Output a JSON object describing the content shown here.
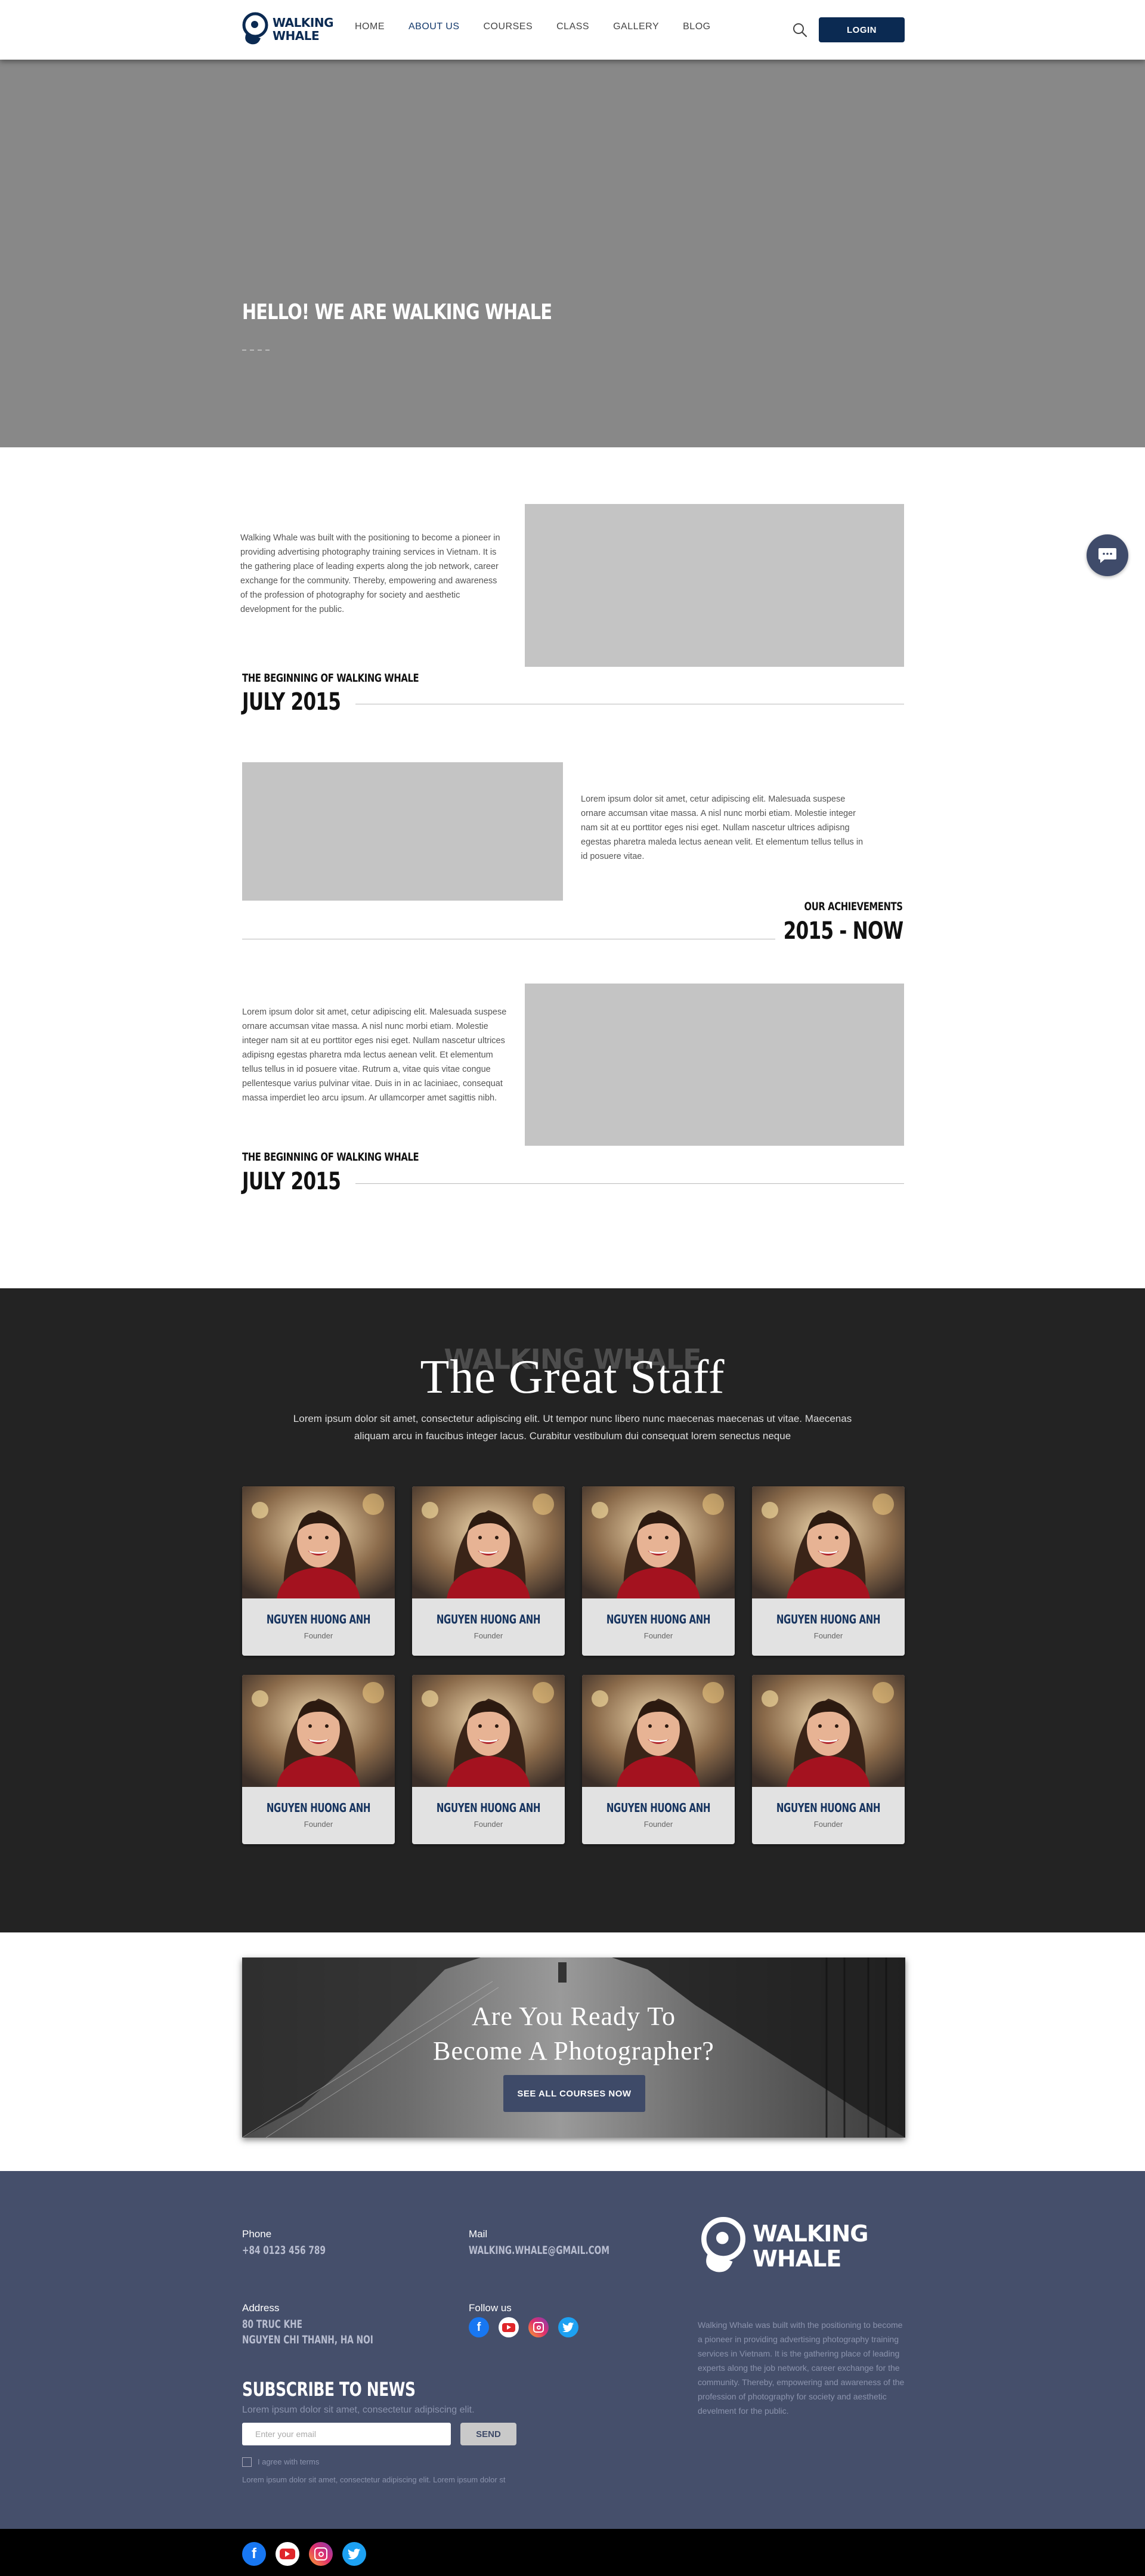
{
  "header": {
    "logo_line1": "WALKING",
    "logo_line2": "WHALE",
    "nav": [
      {
        "label": "HOME"
      },
      {
        "label": "ABOUT US"
      },
      {
        "label": "COURSES"
      },
      {
        "label": "CLASS"
      },
      {
        "label": "GALLERY"
      },
      {
        "label": "BLOG"
      }
    ],
    "active_nav": "ABOUT US",
    "login_label": "LOGIN"
  },
  "hero": {
    "title": "HELLO! WE ARE WALKING WHALE"
  },
  "about": {
    "intro": "Walking Whale was built with the positioning to become a pioneer in providing advertising photography training services in Vietnam. It is the gathering place of leading experts along the job network, career exchange for the community. Thereby, empowering and awareness of the profession of photography for society and aesthetic development for the public.",
    "timeline": [
      {
        "label": "THE BEGINNING OF WALKING WHALE",
        "year": "JULY 2015"
      },
      {
        "label": "OUR ACHIEVEMENTS",
        "year": "2015 - NOW"
      },
      {
        "label": "THE BEGINNING OF WALKING WHALE",
        "year": "JULY 2015"
      }
    ],
    "text2": "Lorem ipsum dolor sit amet, cetur adipiscing elit. Malesuada suspese ornare accumsan vitae massa. A nisl nunc morbi etiam. Molestie integer nam sit at eu porttitor eges nisi eget. Nullam nascetur ultrices adipisng egestas pharetra maleda lectus aenean velit. Et elementum tellus tellus in id posuere vitae.",
    "text3": "Lorem ipsum dolor sit amet, cetur adipiscing elit. Malesuada suspese ornare accumsan vitae massa. A nisl nunc morbi etiam. Molestie integer nam sit at eu porttitor eges nisi eget. Nullam nascetur ultrices adipisng egestas pharetra mda lectus aenean velit. Et elementum tellus tellus in id posuere vitae. Rutrum a, vitae quis vitae congue pellentesque varius pulvinar vitae. Duis in in ac laciniaec, consequat massa imperdiet leo arcu ipsum. Ar ullamcorper amet sagittis nibh."
  },
  "staff": {
    "ghost": "WALKING WHALE",
    "title": "The Great Staff",
    "desc": "Lorem ipsum dolor sit amet, consectetur adipiscing elit. Ut tempor nunc libero nunc maecenas maecenas ut vitae. Maecenas aliquam arcu in faucibus integer lacus. Curabitur vestibulum dui consequat lorem senectus neque",
    "members": [
      {
        "name": "NGUYEN HUONG ANH",
        "role": "Founder"
      },
      {
        "name": "NGUYEN HUONG ANH",
        "role": "Founder"
      },
      {
        "name": "NGUYEN HUONG ANH",
        "role": "Founder"
      },
      {
        "name": "NGUYEN HUONG ANH",
        "role": "Founder"
      },
      {
        "name": "NGUYEN HUONG ANH",
        "role": "Founder"
      },
      {
        "name": "NGUYEN HUONG ANH",
        "role": "Founder"
      },
      {
        "name": "NGUYEN HUONG ANH",
        "role": "Founder"
      },
      {
        "name": "NGUYEN HUONG ANH",
        "role": "Founder"
      }
    ]
  },
  "cta": {
    "line1": "Are You Ready To",
    "line2": "Become A Photographer?",
    "button": "SEE ALL COURSES NOW"
  },
  "footer": {
    "phone_label": "Phone",
    "phone": "+84 0123 456 789",
    "mail_label": "Mail",
    "mail": "WALKING.WHALE@GMAIL.COM",
    "address_label": "Address",
    "address_line1": "80 TRUC KHE",
    "address_line2": "NGUYEN CHI THANH, HA NOI",
    "follow_label": "Follow us",
    "logo_line1": "WALKING",
    "logo_line2": "WHALE",
    "about": "Walking Whale was built with the positioning to become a pioneer in providing advertising photography training services in Vietnam. It is the gathering place of leading experts along the job network, career exchange for the community. Thereby, empowering and awareness of the profession of photography for society and aesthetic develment for the public.",
    "subscribe_title": "SUBSCRIBE TO NEWS",
    "subscribe_desc": "Lorem ipsum dolor sit amet, consectetur adipiscing elit.",
    "email_placeholder": "Enter your email",
    "send_label": "SEND",
    "agree_label": "I agree with terms",
    "note": "Lorem ipsum dolor sit amet, consectetur adipiscing elit. Lorem ipsum dolor st"
  },
  "social_icons": [
    "facebook-icon",
    "youtube-icon",
    "instagram-icon",
    "twitter-icon"
  ],
  "colors": {
    "brand_navy": "#0b2a52",
    "footer_bg": "#454f6b",
    "staff_bg": "#232323",
    "hero_bg": "#888888",
    "placeholder": "#c4c4c4"
  }
}
